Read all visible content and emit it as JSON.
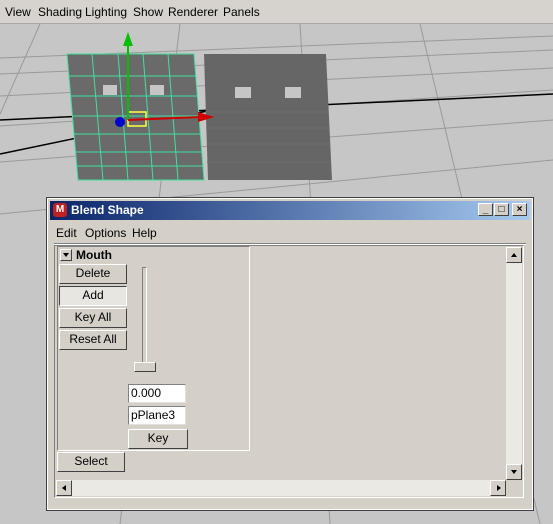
{
  "viewport_menu": [
    "View",
    "Shading",
    "Lighting",
    "Show",
    "Renderer",
    "Panels"
  ],
  "window": {
    "title": "Blend Shape",
    "title_icon": "maya-logo-icon",
    "controls": {
      "minimize": "_",
      "maximize": "□",
      "close": "×"
    }
  },
  "window_menu": [
    "Edit",
    "Options",
    "Help"
  ],
  "blend_shape": {
    "name": "Mouth",
    "buttons": {
      "delete": "Delete",
      "add": "Add",
      "key_all": "Key All",
      "reset_all": "Reset All"
    },
    "target": {
      "weight": "0.000",
      "weight_level": 0.0,
      "name": "pPlane3",
      "key_label": "Key"
    },
    "select_label": "Select"
  },
  "colors": {
    "viewport_bg": "#c6c6c6",
    "wireframe_selected": "#40e0a0",
    "mesh_gray": "#666666",
    "axis_y": "#00c000",
    "axis_x": "#d00000",
    "axis_z": "#0000d0",
    "title_gradient_start": "#0a246a",
    "title_gradient_end": "#a6caf0"
  }
}
